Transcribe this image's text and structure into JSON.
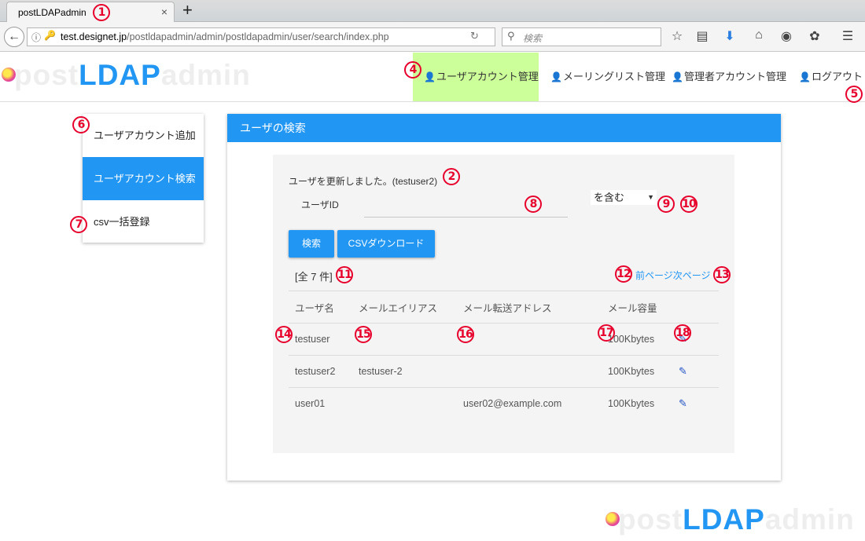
{
  "browser": {
    "tab_title": "postLDAPadmin",
    "tab_close": "×",
    "new_tab": "+",
    "url_domain": "test.designet.jp",
    "url_path": "/postldapadmin/admin/postldapadmin/user/search/index.php",
    "search_placeholder": "検索",
    "icons": [
      "back-icon",
      "info-icon",
      "key-icon",
      "reload-icon",
      "search-icon",
      "star-icon",
      "reader-icon",
      "download-icon",
      "home-icon",
      "pocket-icon",
      "extension-icon",
      "menu-icon"
    ]
  },
  "app": {
    "logo": {
      "part1": "post",
      "part2": "LDAP",
      "part3": "admin"
    },
    "nav": [
      {
        "label": "ユーザアカウント管理",
        "active": true
      },
      {
        "label": "メーリングリスト管理"
      },
      {
        "label": "管理者アカウント管理"
      },
      {
        "label": "ログアウト"
      }
    ],
    "accent_color": "#2196f3",
    "active_nav_color": "#ccff99"
  },
  "sidebar": {
    "items": [
      {
        "label": "ユーザアカウント追加"
      },
      {
        "label": "ユーザアカウント検索",
        "active": true
      },
      {
        "label": "csv一括登録"
      }
    ]
  },
  "panel": {
    "title": "ユーザの検索",
    "message": "ユーザを更新しました。(testuser2)",
    "uid_label": "ユーザID",
    "uid_value": "",
    "match_option": "を含む",
    "search_button": "検索",
    "csv_button": "CSVダウンロード",
    "count": "[全 7 件]",
    "prev_page": "前ページ",
    "next_page": "次ページ",
    "columns": [
      "ユーザ名",
      "メールエイリアス",
      "メール転送アドレス",
      "メール容量",
      ""
    ],
    "rows": [
      {
        "user": "testuser",
        "alias": "",
        "forward": "",
        "quota": "100Kbytes"
      },
      {
        "user": "testuser2",
        "alias": "testuser-2",
        "forward": "",
        "quota": "100Kbytes"
      },
      {
        "user": "user01",
        "alias": "",
        "forward": "user02@example.com",
        "quota": "100Kbytes"
      }
    ]
  },
  "markers": [
    "1",
    "2",
    "4",
    "5",
    "6",
    "7",
    "8",
    "9",
    "10",
    "11",
    "12",
    "13",
    "14",
    "15",
    "16",
    "17",
    "18"
  ]
}
